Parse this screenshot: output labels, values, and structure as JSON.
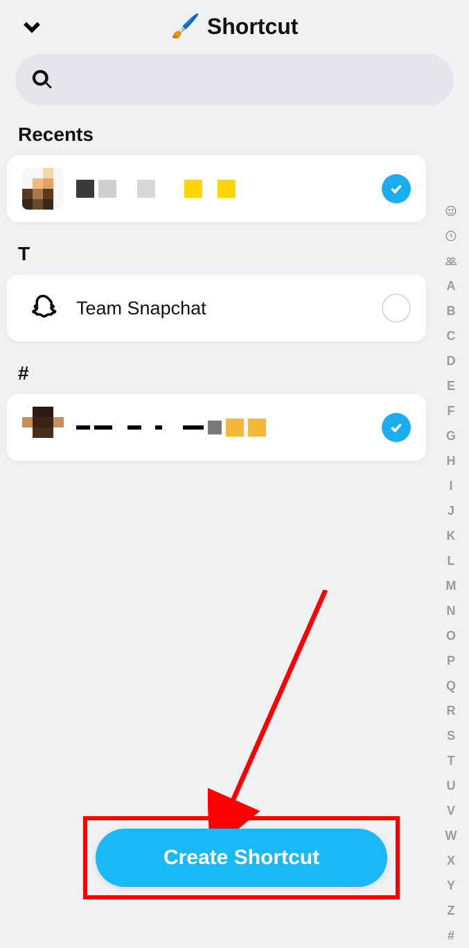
{
  "header": {
    "title": "Shortcut",
    "emoji": "🖌️"
  },
  "search": {
    "placeholder": ""
  },
  "sections": {
    "recents_label": "Recents",
    "t_label": "T",
    "hash_label": "#"
  },
  "rows": {
    "recent1": {
      "name_redacted": true,
      "selected": true
    },
    "team": {
      "name": "Team Snapchat",
      "selected": false
    },
    "hash1": {
      "name_redacted": true,
      "selected": true
    }
  },
  "index": {
    "letters": [
      "A",
      "B",
      "C",
      "D",
      "E",
      "F",
      "G",
      "H",
      "I",
      "J",
      "K",
      "L",
      "M",
      "N",
      "O",
      "P",
      "Q",
      "R",
      "S",
      "T",
      "U",
      "V",
      "W",
      "X",
      "Y",
      "Z",
      "#"
    ]
  },
  "cta": {
    "label": "Create Shortcut"
  },
  "colors": {
    "accent": "#1ab8f5",
    "annotation": "#ff0000"
  }
}
